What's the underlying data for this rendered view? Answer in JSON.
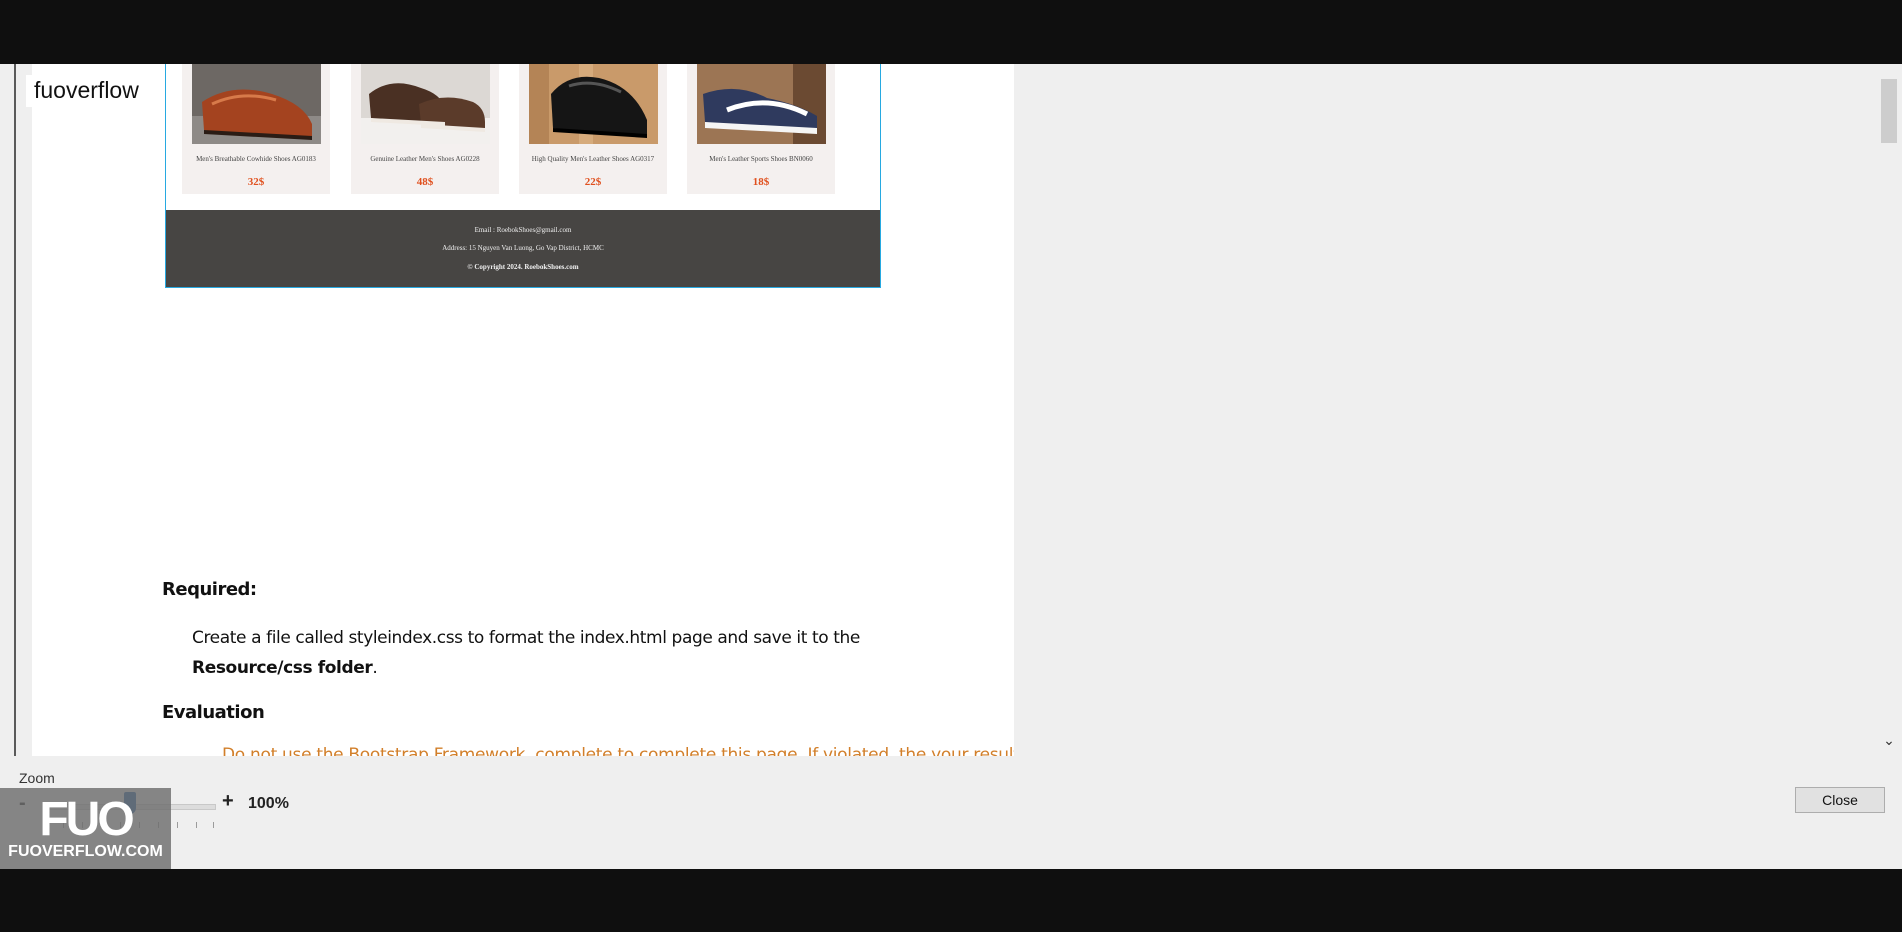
{
  "overlay": {
    "label": "fuoverflow"
  },
  "products": [
    {
      "name": "Men's Breathable Cowhide Shoes AG0183",
      "price": "32$"
    },
    {
      "name": "Genuine Leather Men's Shoes AG0228",
      "price": "48$"
    },
    {
      "name": "High Quality Men's Leather Shoes AG0317",
      "price": "22$"
    },
    {
      "name": "Men's Leather Sports Shoes BN0060",
      "price": "18$"
    }
  ],
  "site_footer": {
    "email": "Email : RoebokShoes@gmail.com",
    "address": "Address: 15 Nguyen Van Luong, Go Vap District, HCMC",
    "copyright": "© Copyright 2024. RoebokShoes.com"
  },
  "document": {
    "required_heading": "Required:",
    "required_text_pre": "Create a file called styleindex.css to format the index.html page and save it to the",
    "required_path": "Resource/css  folder",
    "required_period": ".",
    "evaluation_heading": "Evaluation",
    "evaluation_partial": "Do not use the Bootstrap Framework, complete to complete this page. If violated, the your result..."
  },
  "zoom": {
    "label": "Zoom",
    "minus": "-",
    "plus": "+",
    "value": "100%",
    "level_fraction": 0.5
  },
  "buttons": {
    "close": "Close"
  },
  "watermark": {
    "logo": "FUO",
    "site": "FUOVERFLOW.COM"
  },
  "colors": {
    "price": "#e0501e",
    "frame_border": "#27a9e1",
    "footer_bg": "#474543",
    "slider_thumb": "#1d5fa8",
    "evaluation_text": "#d27f2a"
  }
}
